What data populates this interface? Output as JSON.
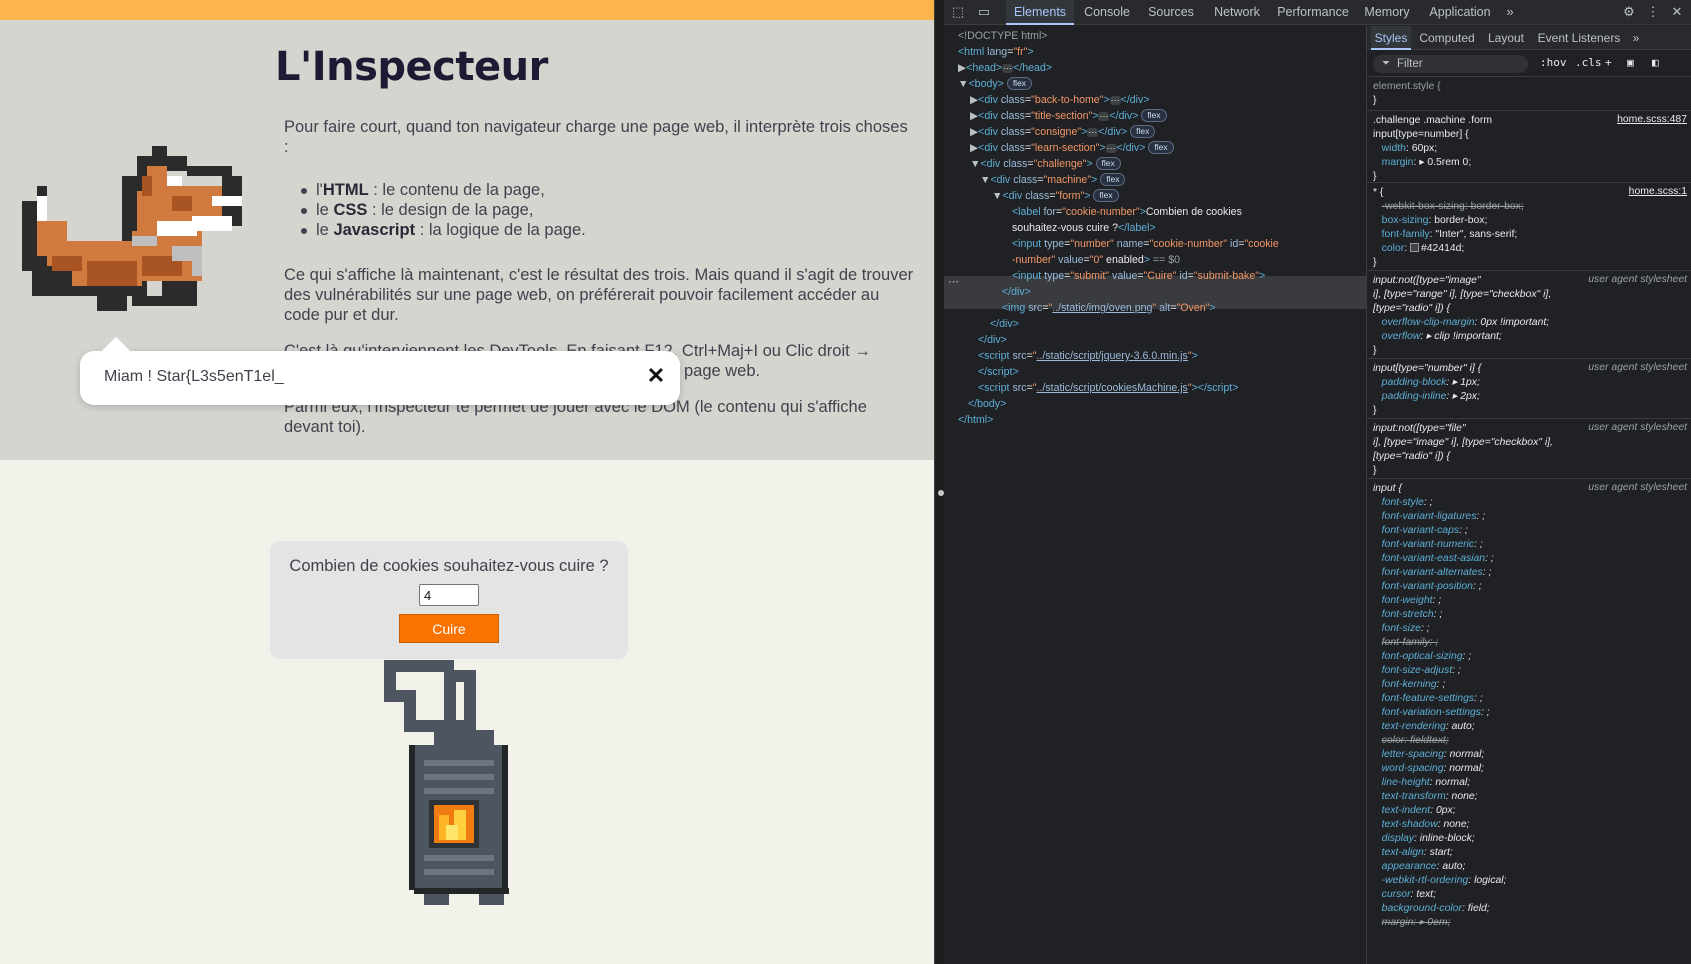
{
  "page": {
    "title": "L'Inspecteur",
    "intro": "Pour faire court, quand ton navigateur charge une page web, il interprète trois choses :",
    "list": [
      {
        "prefix": "l'",
        "bold": "HTML",
        "rest": " : le contenu de la page,"
      },
      {
        "prefix": "le ",
        "bold": "CSS",
        "rest": " : le design de la page,"
      },
      {
        "prefix": "le ",
        "bold": "Javascript",
        "rest": " : la logique de la page."
      }
    ],
    "p2": "Ce qui s'affiche là maintenant, c'est le résultat des trois. Mais quand il s'agit de trouver des vulnérabilités sur une page web, on préférerait pouvoir facilement accéder au code pur et dur.",
    "p3_visible": "s d'analyse de la page web.",
    "p3_partial": "C'est là qu'interviennent les DevTools. En faisant F12, Ctrl+Maj+I ou Clic droit →",
    "p4": "Parmi eux, l'Inspecteur te permet de jouer avec le DOM (le contenu qui s'affiche devant toi).",
    "tooltip": "Miam ! Star{L3s5enT1el_",
    "form_label": "Combien de cookies souhaitez-vous cuire ?",
    "cookie_value": "4",
    "bake_button": "Cuire",
    "colors": {
      "topbar": "#fbb54b",
      "button": "#fa7300",
      "text": "#42414d"
    }
  },
  "devtools": {
    "tabs": [
      "Elements",
      "Console",
      "Sources",
      "Network",
      "Performance",
      "Memory",
      "Application"
    ],
    "active_tab": "Elements",
    "styles_tabs": [
      "Styles",
      "Computed",
      "Layout",
      "Event Listeners"
    ],
    "filter_placeholder": "Filter",
    "hov": ":hov",
    "cls": ".cls"
  }
}
